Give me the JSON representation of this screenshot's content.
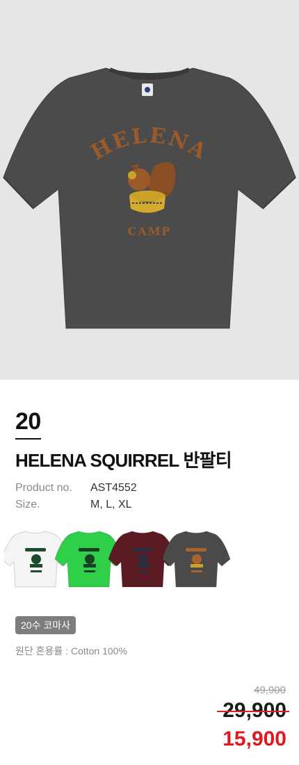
{
  "product": {
    "rank": "20",
    "name": "HELENA SQUIRREL 반팔티",
    "specs": {
      "product_no_label": "Product no.",
      "product_no_value": "AST4552",
      "size_label": "Size.",
      "size_value": "M, L, XL"
    },
    "fabric_badge": "20수 코마사",
    "fabric_blend": "원단 혼용률 : Cotton 100%",
    "prices": {
      "original": "49,900",
      "was": "29,900",
      "sale": "15,900"
    },
    "print_text": {
      "arch": "HELENA",
      "bottom": "CAMP"
    },
    "color_variants": [
      {
        "name": "white",
        "shirt": "#f4f4f4",
        "print": "#1e4a2c"
      },
      {
        "name": "green",
        "shirt": "#2fcf4a",
        "print": "#173f23"
      },
      {
        "name": "burgundy",
        "shirt": "#5a1b23",
        "print": "#2a2f3f"
      },
      {
        "name": "charcoal",
        "shirt": "#4a4a4a",
        "print": "#a8642a"
      }
    ]
  },
  "colors": {
    "hero_bg": "#e6e6e6",
    "hero_shirt": "#4b4b4b",
    "print_brown": "#9c5a2a",
    "print_gold": "#c9a227",
    "sale_red": "#e0191f",
    "badge_bg": "#7d7d7d"
  }
}
